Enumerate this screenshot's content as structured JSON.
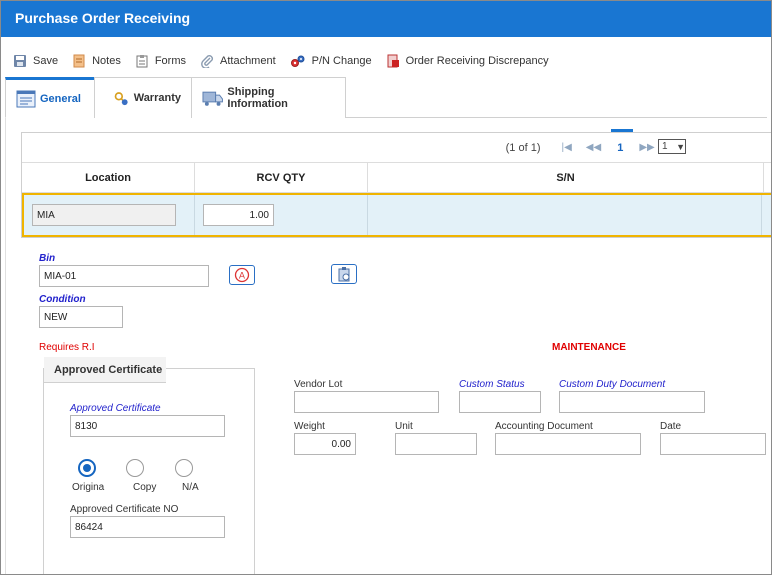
{
  "window": {
    "title": "Purchase Order Receiving"
  },
  "toolbar": {
    "save": "Save",
    "notes": "Notes",
    "forms": "Forms",
    "attachment": "Attachment",
    "pn_change": "P/N Change",
    "discrepancy": "Order Receiving Discrepancy"
  },
  "tabs": {
    "general": "General",
    "warranty": "Warranty",
    "shipping": "Shipping Information"
  },
  "grid": {
    "pager_text": "(1 of 1)",
    "current_page": "1",
    "page_select": "1",
    "columns": {
      "location": "Location",
      "rcv_qty": "RCV QTY",
      "sn": "S/N"
    },
    "row": {
      "location": "MIA",
      "rcv_qty": "1.00",
      "sn": ""
    }
  },
  "form": {
    "bin_label": "Bin",
    "bin_value": "MIA-01",
    "condition_label": "Condition",
    "condition_value": "NEW",
    "requires_ri": "Requires R.I",
    "maintenance": "MAINTENANCE",
    "vendor_lot_label": "Vendor Lot",
    "vendor_lot_value": "",
    "custom_status_label": "Custom Status",
    "custom_status_value": "",
    "custom_duty_label": "Custom Duty Document",
    "custom_duty_value": "",
    "weight_label": "Weight",
    "weight_value": "0.00",
    "unit_label": "Unit",
    "unit_value": "",
    "accounting_doc_label": "Accounting Document",
    "accounting_doc_value": "",
    "date_label": "Date",
    "date_value": ""
  },
  "certificate": {
    "section_title": "Approved Certificate",
    "approved_label": "Approved Certificate",
    "approved_value": "8130",
    "options": [
      "Origina",
      "Copy",
      "N/A"
    ],
    "selected": "Origina",
    "number_label": "Approved Certificate NO",
    "number_value": "86424"
  },
  "colors": {
    "title_bar": "#1976d2",
    "selected_row": "#e3f1f8",
    "row_border": "#f0b400",
    "alert": "#e00000"
  }
}
